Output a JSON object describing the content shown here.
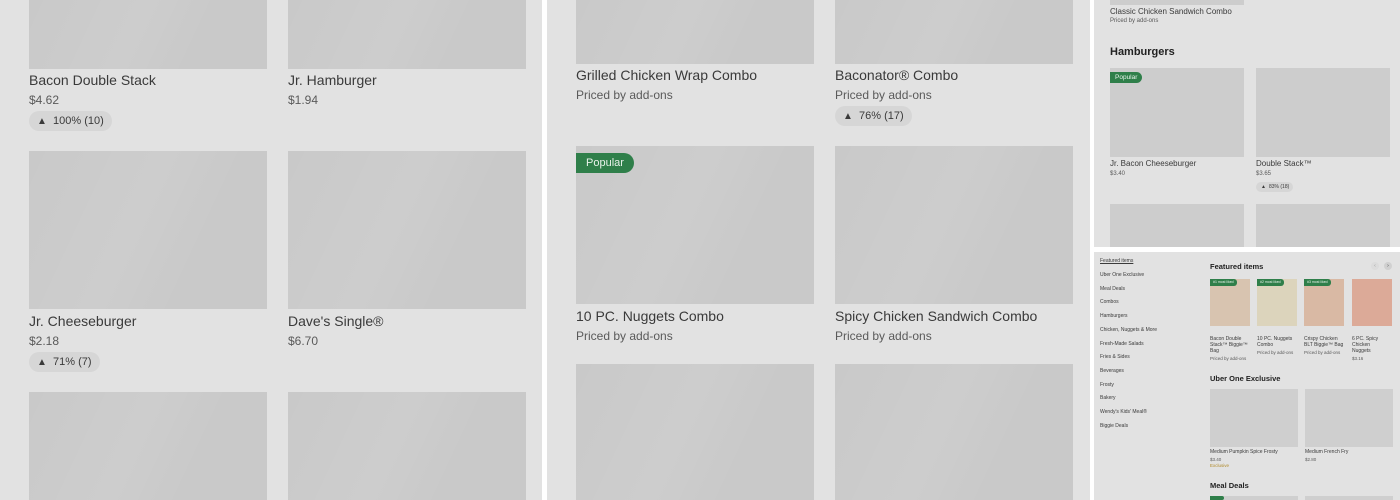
{
  "panel1": {
    "items": [
      {
        "name": "Bacon Double Stack",
        "price": "$4.62",
        "rating": "100% (10)"
      },
      {
        "name": "Jr. Hamburger",
        "price": "$1.94"
      },
      {
        "name": "Jr. Cheeseburger",
        "price": "$2.18",
        "rating": "71% (7)"
      },
      {
        "name": "Dave's Single®",
        "price": "$6.70"
      }
    ]
  },
  "panel2": {
    "items": [
      {
        "name": "Grilled Chicken Wrap Combo",
        "price": "Priced by add-ons"
      },
      {
        "name": "Baconator® Combo",
        "price": "Priced by add-ons",
        "rating": "76% (17)"
      },
      {
        "name": "10 PC. Nuggets Combo",
        "price": "Priced by add-ons",
        "badge": "Popular"
      },
      {
        "name": "Spicy Chicken Sandwich Combo",
        "price": "Priced by add-ons"
      }
    ]
  },
  "panel3": {
    "top_item": {
      "name": "Classic Chicken Sandwich Combo",
      "price": "Priced by add-ons"
    },
    "section_title": "Hamburgers",
    "items": [
      {
        "name": "Jr. Bacon Cheeseburger",
        "price": "$3.40",
        "badge": "Popular"
      },
      {
        "name": "Double Stack™",
        "price": "$3.65",
        "rating": "83% (18)"
      }
    ]
  },
  "panel4": {
    "nav": [
      "Featured items",
      "Uber One Exclusive",
      "Meal Deals",
      "Combos",
      "Hamburgers",
      "Chicken, Nuggets & More",
      "Fresh-Made Salads",
      "Fries & Sides",
      "Beverages",
      "Frosty",
      "Bakery",
      "Wendy's Kids' Meal®",
      "Biggie Deals"
    ],
    "featured_title": "Featured items",
    "featured": [
      {
        "badge": "#1 most liked",
        "name": "Bacon Double Stack™ Biggie™ Bag",
        "price": "Priced by add-ons"
      },
      {
        "badge": "#2 most liked",
        "name": "10 PC. Nuggets Combo",
        "price": "Priced by add-ons"
      },
      {
        "badge": "#3 most liked",
        "name": "Crispy Chicken BLT Biggie™ Bag",
        "price": "Priced by add-ons"
      },
      {
        "name": "6 PC. Spicy Chicken Nuggets",
        "price": "$3.16"
      }
    ],
    "uber_title": "Uber One Exclusive",
    "uber_items": [
      {
        "name": "Medium Pumpkin Spice Frosty",
        "price": "$3.40",
        "tag": "Exclusive"
      },
      {
        "name": "Medium French Fry",
        "price": "$2.80"
      }
    ],
    "meal_deals_title": "Meal Deals",
    "arrow_prev": "‹",
    "arrow_next": "›"
  },
  "icons": {
    "thumbs_up": "👍"
  }
}
